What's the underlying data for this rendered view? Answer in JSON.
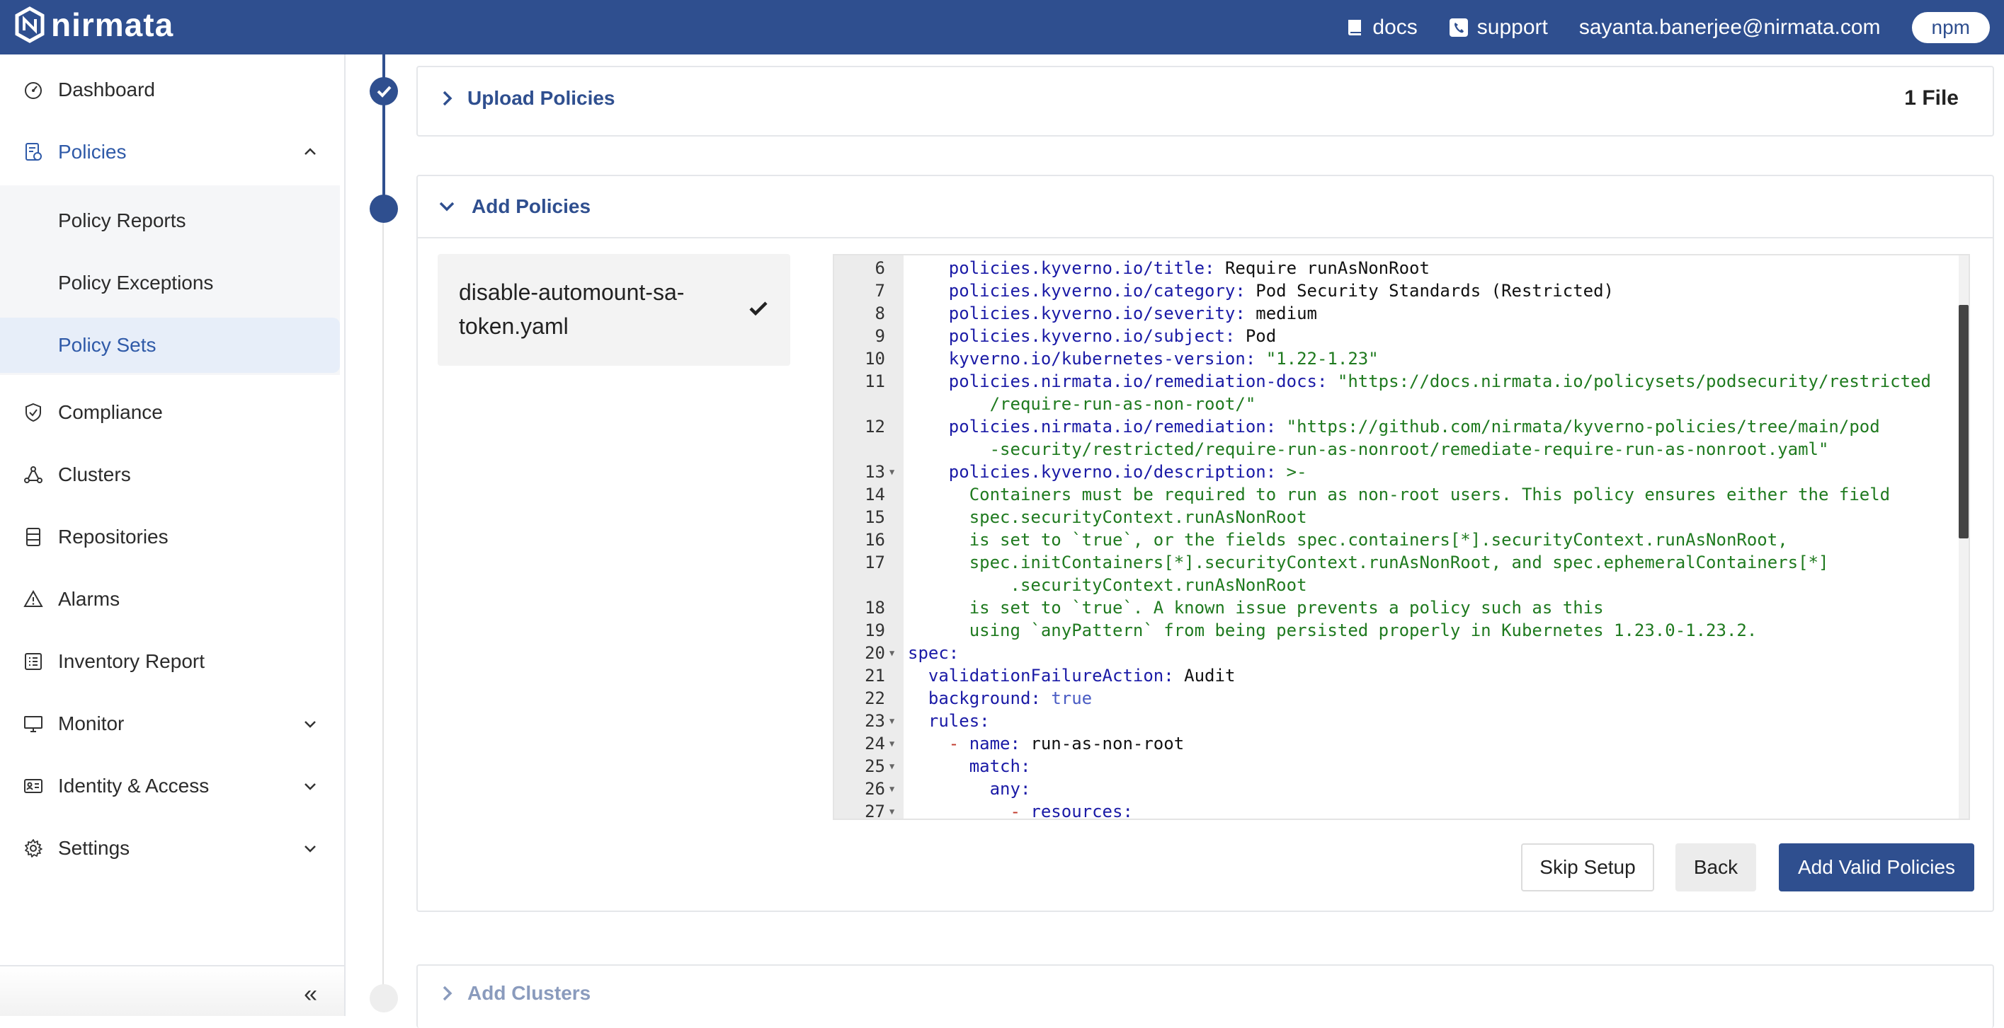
{
  "topbar": {
    "logo_text": "nirmata",
    "docs_label": "docs",
    "support_label": "support",
    "user_email": "sayanta.banerjee@nirmata.com",
    "npm_label": "npm",
    "background_color": "#2f4f8f"
  },
  "sidebar": {
    "dashboard": "Dashboard",
    "policies": "Policies",
    "sub_items": [
      "Policy Reports",
      "Policy Exceptions",
      "Policy Sets"
    ],
    "selected_sub": "Policy Sets",
    "compliance": "Compliance",
    "clusters": "Clusters",
    "repositories": "Repositories",
    "alarms": "Alarms",
    "inventory_report": "Inventory Report",
    "monitor": "Monitor",
    "identity_access": "Identity & Access",
    "settings": "Settings",
    "collapse_label": "«"
  },
  "steps": {
    "upload": {
      "title": "Upload Policies",
      "count": "1 File",
      "status": "completed"
    },
    "add": {
      "title": "Add Policies",
      "status": "current"
    },
    "clusters": {
      "title": "Add Clusters",
      "status": "pending"
    }
  },
  "file_list": [
    {
      "name": "disable-automount-sa-token.yaml",
      "valid": true
    }
  ],
  "editor": {
    "lines": [
      {
        "n": "6",
        "html": "    <span class=\"k\">policies.kyverno.io/title:</span> <span class=\"v\">Require runAsNonRoot</span>"
      },
      {
        "n": "7",
        "html": "    <span class=\"k\">policies.kyverno.io/category:</span> <span class=\"v\">Pod Security Standards (Restricted)</span>"
      },
      {
        "n": "8",
        "html": "    <span class=\"k\">policies.kyverno.io/severity:</span> <span class=\"v\">medium</span>"
      },
      {
        "n": "9",
        "html": "    <span class=\"k\">policies.kyverno.io/subject:</span> <span class=\"v\">Pod</span>"
      },
      {
        "n": "10",
        "html": "    <span class=\"k\">kyverno.io/kubernetes-version:</span> <span class=\"s\">\"1.22-1.23\"</span>"
      },
      {
        "n": "11",
        "html": "    <span class=\"k\">policies.nirmata.io/remediation-docs:</span> <span class=\"s\">\"https://docs.nirmata.io/policysets/podsecurity/restricted</span>"
      },
      {
        "n": "",
        "html": "        <span class=\"s\">/require-run-as-non-root/\"</span>"
      },
      {
        "n": "12",
        "html": "    <span class=\"k\">policies.nirmata.io/remediation:</span> <span class=\"s\">\"https://github.com/nirmata/kyverno-policies/tree/main/pod</span>"
      },
      {
        "n": "",
        "html": "        <span class=\"s\">-security/restricted/require-run-as-nonroot/remediate-require-run-as-nonroot.yaml\"</span>"
      },
      {
        "n": "13",
        "fold": true,
        "html": "    <span class=\"k\">policies.kyverno.io/description:</span> <span class=\"s\">&gt;-</span>"
      },
      {
        "n": "14",
        "html": "      <span class=\"s\">Containers must be required to run as non-root users. This policy ensures either the field</span>"
      },
      {
        "n": "15",
        "html": "      <span class=\"s\">spec.securityContext.runAsNonRoot</span>"
      },
      {
        "n": "16",
        "html": "      <span class=\"s\">is set to `true`, or the fields spec.containers[*].securityContext.runAsNonRoot,</span>"
      },
      {
        "n": "17",
        "html": "      <span class=\"s\">spec.initContainers[*].securityContext.runAsNonRoot, and spec.ephemeralContainers[*]</span>"
      },
      {
        "n": "",
        "html": "          <span class=\"s\">.securityContext.runAsNonRoot</span>"
      },
      {
        "n": "18",
        "html": "      <span class=\"s\">is set to `true`. A known issue prevents a policy such as this</span>"
      },
      {
        "n": "19",
        "html": "      <span class=\"s\">using `anyPattern` from being persisted properly in Kubernetes 1.23.0-1.23.2.</span>"
      },
      {
        "n": "20",
        "fold": true,
        "html": "<span class=\"k\">spec:</span>"
      },
      {
        "n": "21",
        "html": "  <span class=\"k\">validationFailureAction:</span> <span class=\"v\">Audit</span>"
      },
      {
        "n": "22",
        "html": "  <span class=\"k\">background:</span> <span class=\"b\">true</span>"
      },
      {
        "n": "23",
        "fold": true,
        "html": "  <span class=\"k\">rules:</span>"
      },
      {
        "n": "24",
        "fold": true,
        "html": "    <span class=\"d\">-</span> <span class=\"k\">name:</span> <span class=\"v\">run-as-non-root</span>"
      },
      {
        "n": "25",
        "fold": true,
        "html": "      <span class=\"k\">match:</span>"
      },
      {
        "n": "26",
        "fold": true,
        "html": "        <span class=\"k\">any:</span>"
      },
      {
        "n": "27",
        "fold": true,
        "html": "          <span class=\"d\">-</span> <span class=\"k\">resources:</span>"
      }
    ]
  },
  "actions": {
    "skip": "Skip Setup",
    "back": "Back",
    "add_valid": "Add Valid Policies",
    "primary_color": "#2f4f8f"
  }
}
